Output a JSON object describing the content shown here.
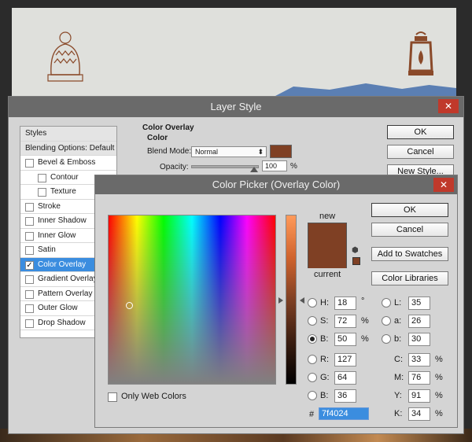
{
  "layer_style": {
    "title": "Layer Style",
    "close_label": "✕",
    "sidebar": [
      {
        "label": "Styles",
        "type": "header",
        "checkbox": false,
        "checked": false
      },
      {
        "label": "Blending Options: Default",
        "type": "header",
        "checkbox": false,
        "checked": false
      },
      {
        "label": "Bevel & Emboss",
        "type": "item",
        "checkbox": true,
        "checked": false
      },
      {
        "label": "Contour",
        "type": "sub",
        "checkbox": true,
        "checked": false
      },
      {
        "label": "Texture",
        "type": "sub",
        "checkbox": true,
        "checked": false
      },
      {
        "label": "Stroke",
        "type": "item",
        "checkbox": true,
        "checked": false
      },
      {
        "label": "Inner Shadow",
        "type": "item",
        "checkbox": true,
        "checked": false
      },
      {
        "label": "Inner Glow",
        "type": "item",
        "checkbox": true,
        "checked": false
      },
      {
        "label": "Satin",
        "type": "item",
        "checkbox": true,
        "checked": false
      },
      {
        "label": "Color Overlay",
        "type": "item",
        "checkbox": true,
        "checked": true,
        "selected": true
      },
      {
        "label": "Gradient Overlay",
        "type": "item",
        "checkbox": true,
        "checked": false
      },
      {
        "label": "Pattern Overlay",
        "type": "item",
        "checkbox": true,
        "checked": false
      },
      {
        "label": "Outer Glow",
        "type": "item",
        "checkbox": true,
        "checked": false
      },
      {
        "label": "Drop Shadow",
        "type": "item",
        "checkbox": true,
        "checked": false
      }
    ],
    "section_title": "Color Overlay",
    "subsection_title": "Color",
    "blend_mode_label": "Blend Mode:",
    "blend_mode_value": "Normal",
    "opacity_label": "Opacity:",
    "opacity_value": "100",
    "opacity_unit": "%",
    "overlay_color": "#7f4024",
    "ok_label": "OK",
    "cancel_label": "Cancel",
    "new_style_label": "New Style..."
  },
  "color_picker": {
    "title": "Color Picker (Overlay Color)",
    "close_label": "✕",
    "new_label": "new",
    "current_label": "current",
    "new_color": "#7f4024",
    "current_color": "#7f4024",
    "ok_label": "OK",
    "cancel_label": "Cancel",
    "add_swatches_label": "Add to Swatches",
    "color_libraries_label": "Color Libraries",
    "only_web_colors_label": "Only Web Colors",
    "fields": {
      "H": {
        "label": "H:",
        "value": "18",
        "unit": "°",
        "checked": false
      },
      "S": {
        "label": "S:",
        "value": "72",
        "unit": "%",
        "checked": false
      },
      "B": {
        "label": "B:",
        "value": "50",
        "unit": "%",
        "checked": true
      },
      "R": {
        "label": "R:",
        "value": "127",
        "checked": false
      },
      "G": {
        "label": "G:",
        "value": "64",
        "checked": false
      },
      "Bl": {
        "label": "B:",
        "value": "36",
        "checked": false
      },
      "L": {
        "label": "L:",
        "value": "35",
        "checked": false
      },
      "a": {
        "label": "a:",
        "value": "26",
        "checked": false
      },
      "b": {
        "label": "b:",
        "value": "30",
        "checked": false
      },
      "C": {
        "label": "C:",
        "value": "33",
        "unit": "%"
      },
      "M": {
        "label": "M:",
        "value": "76",
        "unit": "%"
      },
      "Y": {
        "label": "Y:",
        "value": "91",
        "unit": "%"
      },
      "K": {
        "label": "K:",
        "value": "34",
        "unit": "%"
      }
    },
    "hex_label": "#",
    "hex_value": "7f4024"
  }
}
